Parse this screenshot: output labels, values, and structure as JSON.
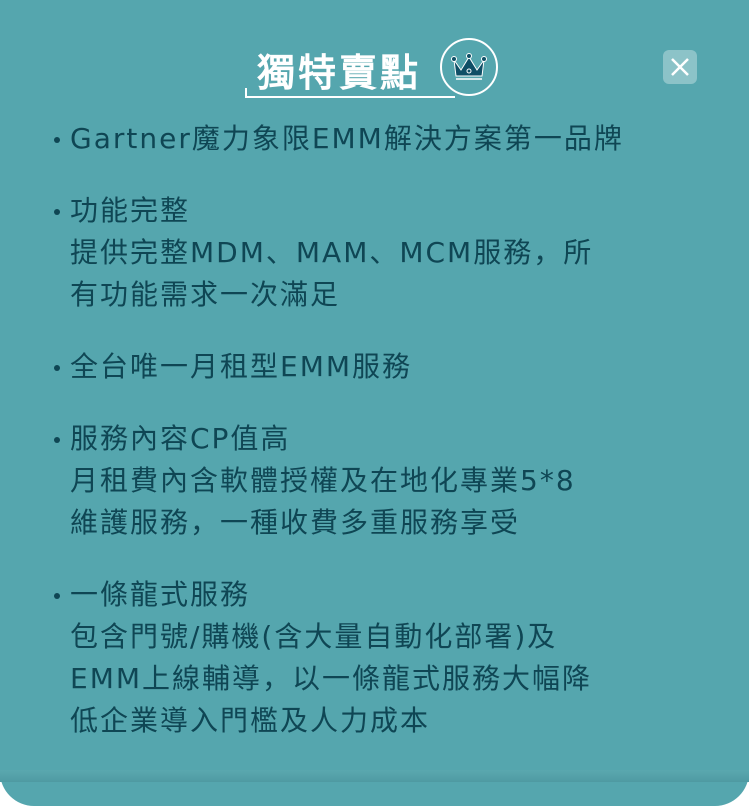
{
  "title": "獨特賣點",
  "items": [
    {
      "head": "Gartner魔力象限EMM解決方案第一品牌",
      "body": []
    },
    {
      "head": "功能完整",
      "body": [
        "提供完整MDM、MAM、MCM服務，所",
        "有功能需求一次滿足"
      ]
    },
    {
      "head": "全台唯一月租型EMM服務",
      "body": []
    },
    {
      "head": "服務內容CP值高",
      "body": [
        "月租費內含軟體授權及在地化專業5*8",
        "維護服務，一種收費多重服務享受"
      ]
    },
    {
      "head": "一條龍式服務",
      "body": [
        "包含門號/購機(含大量自動化部署)及",
        "EMM上線輔導，以一條龍式服務大幅降",
        "低企業導入門檻及人力成本"
      ]
    }
  ]
}
